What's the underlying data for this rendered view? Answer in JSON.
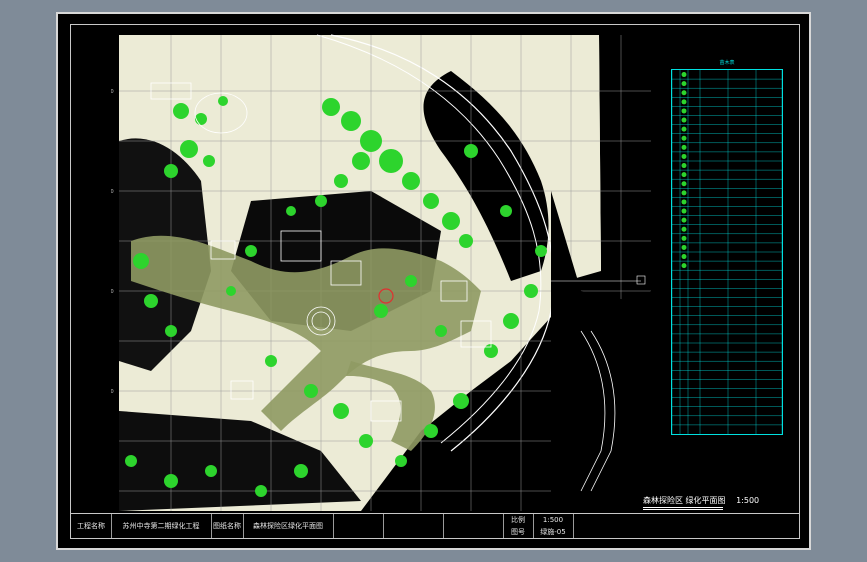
{
  "title_block": {
    "project_label": "工程名称",
    "project_value": "苏州中寺第二期绿化工程",
    "drawing_label": "图纸名称",
    "drawing_value": "森林探险区绿化平面图",
    "scale_label": "比例",
    "scale_value": "1:500",
    "drawing_no_label": "图号",
    "drawing_no_value": "绿施-05"
  },
  "drawing_title": {
    "name": "森林探险区 绿化平面图",
    "scale": "1:500"
  },
  "legend": {
    "header": "苗木表",
    "rows": 40
  },
  "grid_labels": [
    "1700",
    "1800",
    "1900",
    "2000"
  ],
  "colors": {
    "background": "#000000",
    "page": "#7f8b98",
    "frame": "#d8d8d8",
    "land": "#ecebd6",
    "vegetation": "#2dd42d",
    "path": "#8f9a63",
    "table_lines": "#00e0e0",
    "grid": "#9a9a9a"
  }
}
